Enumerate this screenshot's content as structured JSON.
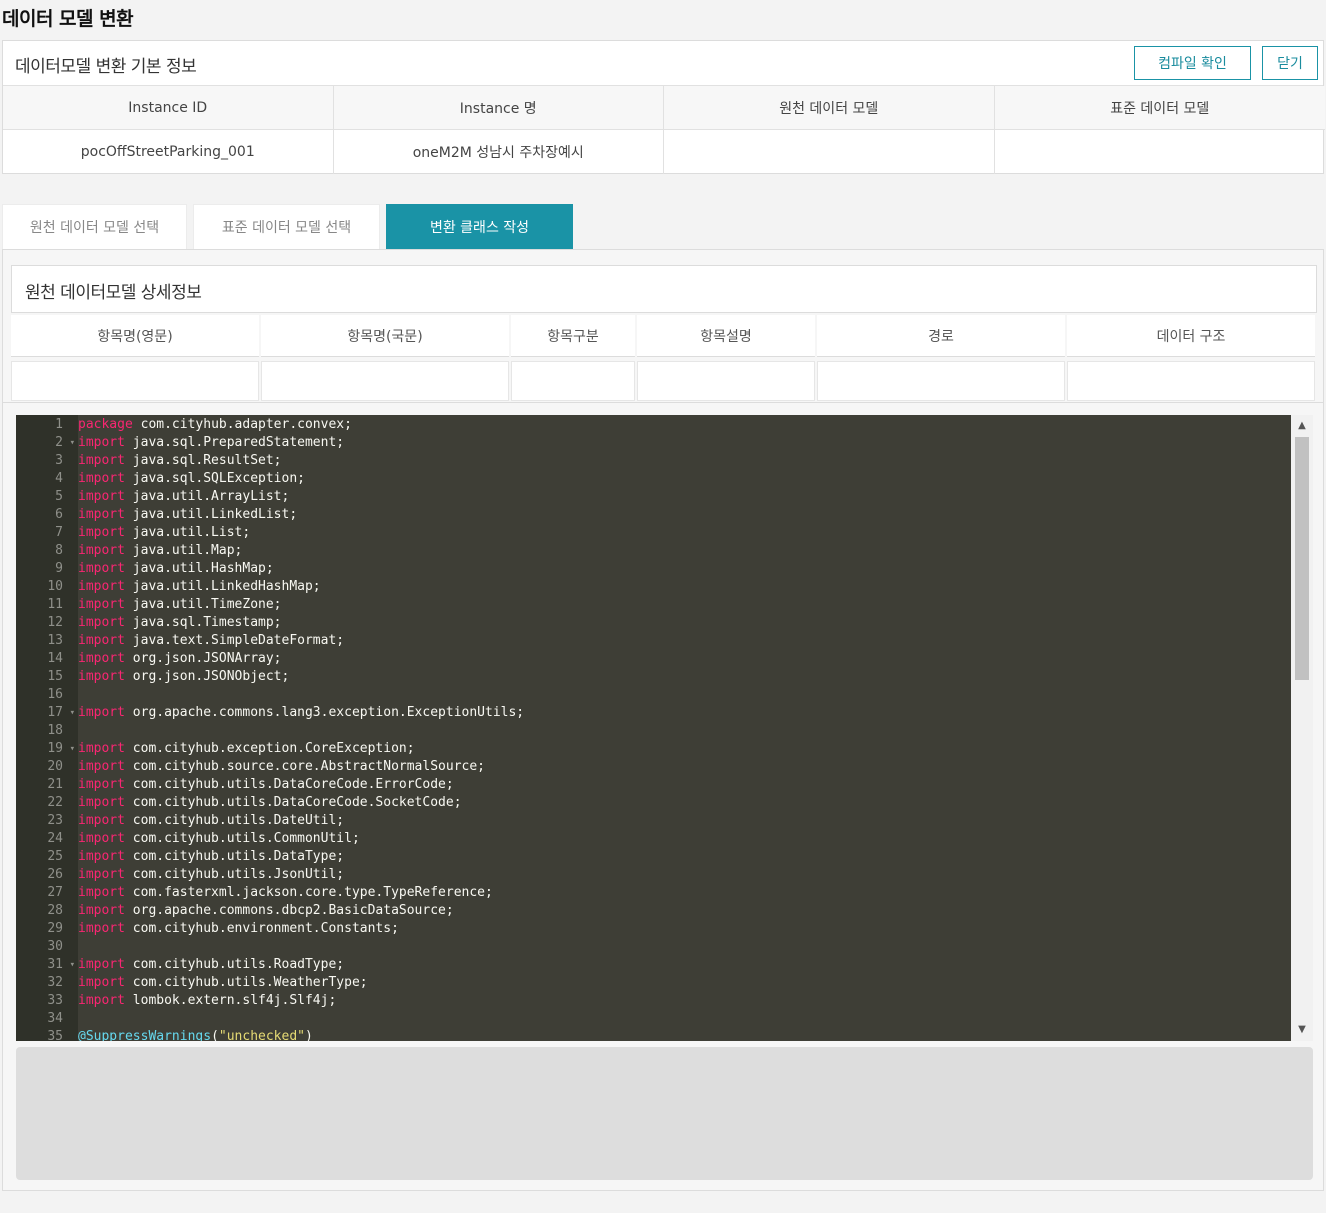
{
  "page_title": "데이터 모델 변환",
  "info": {
    "title": "데이터모델 변환 기본 정보",
    "compile_label": "컴파일 확인",
    "close_label": "닫기",
    "headers": [
      "Instance ID",
      "Instance 명",
      "원천 데이터 모델",
      "표준 데이터 모델"
    ],
    "values": [
      "pocOffStreetParking_001",
      "oneM2M 성남시 주차장예시",
      "",
      ""
    ]
  },
  "tabs": [
    {
      "label": "원천 데이터 모델 선택"
    },
    {
      "label": "표준 데이터 모델 선택"
    },
    {
      "label": "변환 클래스 작성"
    }
  ],
  "detail": {
    "title": "원천 데이터모델 상세정보",
    "headers": [
      "항목명(영문)",
      "항목명(국문)",
      "항목구분",
      "항목설명",
      "경로",
      "데이터 구조"
    ]
  },
  "editor": {
    "lines": [
      {
        "n": "1",
        "kw": "package",
        "rest": " com.cityhub.adapter.convex;"
      },
      {
        "n": "2",
        "kw": "import",
        "rest": " java.sql.PreparedStatement;",
        "fold": true
      },
      {
        "n": "3",
        "kw": "import",
        "rest": " java.sql.ResultSet;"
      },
      {
        "n": "4",
        "kw": "import",
        "rest": " java.sql.SQLException;"
      },
      {
        "n": "5",
        "kw": "import",
        "rest": " java.util.ArrayList;"
      },
      {
        "n": "6",
        "kw": "import",
        "rest": " java.util.LinkedList;"
      },
      {
        "n": "7",
        "kw": "import",
        "rest": " java.util.List;"
      },
      {
        "n": "8",
        "kw": "import",
        "rest": " java.util.Map;"
      },
      {
        "n": "9",
        "kw": "import",
        "rest": " java.util.HashMap;"
      },
      {
        "n": "10",
        "kw": "import",
        "rest": " java.util.LinkedHashMap;"
      },
      {
        "n": "11",
        "kw": "import",
        "rest": " java.util.TimeZone;"
      },
      {
        "n": "12",
        "kw": "import",
        "rest": " java.sql.Timestamp;"
      },
      {
        "n": "13",
        "kw": "import",
        "rest": " java.text.SimpleDateFormat;"
      },
      {
        "n": "14",
        "kw": "import",
        "rest": " org.json.JSONArray;"
      },
      {
        "n": "15",
        "kw": "import",
        "rest": " org.json.JSONObject;"
      },
      {
        "n": "16",
        "kw": "",
        "rest": ""
      },
      {
        "n": "17",
        "kw": "import",
        "rest": " org.apache.commons.lang3.exception.ExceptionUtils;",
        "fold": true
      },
      {
        "n": "18",
        "kw": "",
        "rest": ""
      },
      {
        "n": "19",
        "kw": "import",
        "rest": " com.cityhub.exception.CoreException;",
        "fold": true
      },
      {
        "n": "20",
        "kw": "import",
        "rest": " com.cityhub.source.core.AbstractNormalSource;"
      },
      {
        "n": "21",
        "kw": "import",
        "rest": " com.cityhub.utils.DataCoreCode.ErrorCode;"
      },
      {
        "n": "22",
        "kw": "import",
        "rest": " com.cityhub.utils.DataCoreCode.SocketCode;"
      },
      {
        "n": "23",
        "kw": "import",
        "rest": " com.cityhub.utils.DateUtil;"
      },
      {
        "n": "24",
        "kw": "import",
        "rest": " com.cityhub.utils.CommonUtil;"
      },
      {
        "n": "25",
        "kw": "import",
        "rest": " com.cityhub.utils.DataType;"
      },
      {
        "n": "26",
        "kw": "import",
        "rest": " com.cityhub.utils.JsonUtil;"
      },
      {
        "n": "27",
        "kw": "import",
        "rest": " com.fasterxml.jackson.core.type.TypeReference;"
      },
      {
        "n": "28",
        "kw": "import",
        "rest": " org.apache.commons.dbcp2.BasicDataSource;"
      },
      {
        "n": "29",
        "kw": "import",
        "rest": " com.cityhub.environment.Constants;"
      },
      {
        "n": "30",
        "kw": "",
        "rest": ""
      },
      {
        "n": "31",
        "kw": "import",
        "rest": " com.cityhub.utils.RoadType;",
        "fold": true
      },
      {
        "n": "32",
        "kw": "import",
        "rest": " com.cityhub.utils.WeatherType;"
      },
      {
        "n": "33",
        "kw": "import",
        "rest": " lombok.extern.slf4j.Slf4j;"
      },
      {
        "n": "34",
        "kw": "",
        "rest": ""
      },
      {
        "n": "35",
        "kw": "",
        "annotation": "@SuppressWarnings",
        "open": "(",
        "string": "\"unchecked\"",
        "close": ")",
        "rest": ""
      }
    ]
  }
}
